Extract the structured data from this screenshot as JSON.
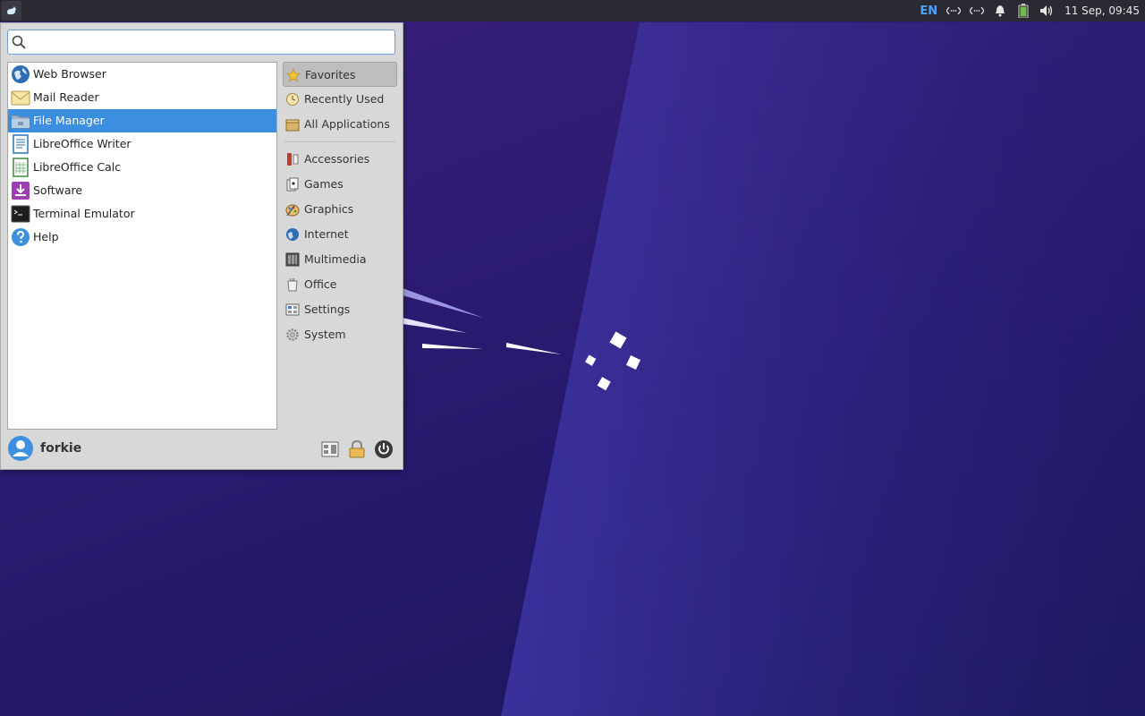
{
  "panel": {
    "language": "EN",
    "clock": "11 Sep, 09:45"
  },
  "search": {
    "value": "",
    "placeholder": ""
  },
  "favorites": [
    {
      "label": "Web Browser",
      "icon": "globe-icon"
    },
    {
      "label": "Mail Reader",
      "icon": "mail-icon"
    },
    {
      "label": "File Manager",
      "icon": "folder-icon",
      "selected": true
    },
    {
      "label": "LibreOffice Writer",
      "icon": "writer-icon"
    },
    {
      "label": "LibreOffice Calc",
      "icon": "calc-icon"
    },
    {
      "label": "Software",
      "icon": "software-icon"
    },
    {
      "label": "Terminal Emulator",
      "icon": "terminal-icon"
    },
    {
      "label": "Help",
      "icon": "help-icon"
    }
  ],
  "categories_top": [
    {
      "label": "Favorites",
      "icon": "star-icon",
      "active": true
    },
    {
      "label": "Recently Used",
      "icon": "clock-icon"
    },
    {
      "label": "All Applications",
      "icon": "box-icon"
    }
  ],
  "categories": [
    {
      "label": "Accessories",
      "icon": "accessories-icon"
    },
    {
      "label": "Games",
      "icon": "games-icon"
    },
    {
      "label": "Graphics",
      "icon": "graphics-icon"
    },
    {
      "label": "Internet",
      "icon": "internet-icon"
    },
    {
      "label": "Multimedia",
      "icon": "multimedia-icon"
    },
    {
      "label": "Office",
      "icon": "office-icon"
    },
    {
      "label": "Settings",
      "icon": "settings-icon"
    },
    {
      "label": "System",
      "icon": "system-icon"
    }
  ],
  "user": {
    "name": "forkie"
  },
  "colors": {
    "selection": "#3c8fe0",
    "panel": "#2b2a33",
    "accent_lang": "#4aa3ff"
  }
}
